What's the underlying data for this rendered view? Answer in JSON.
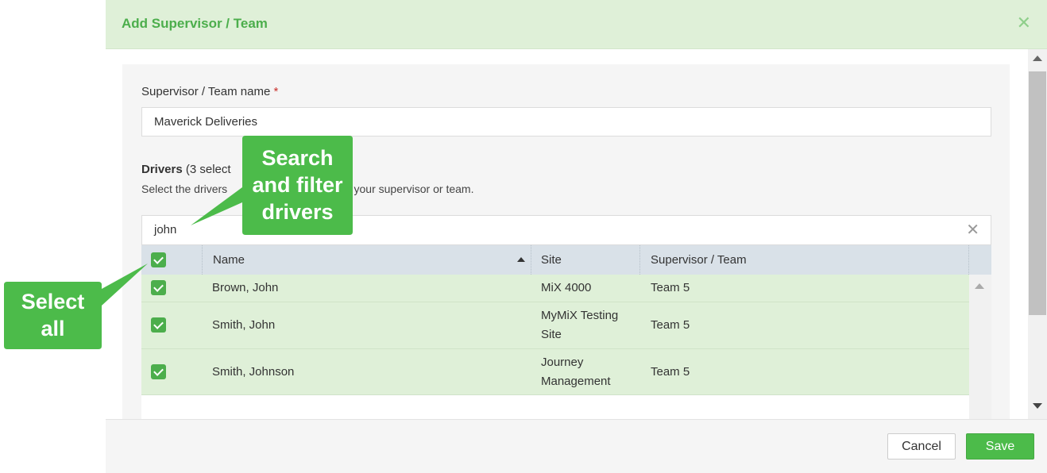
{
  "modal": {
    "title": "Add Supervisor / Team",
    "close_glyph": "✕"
  },
  "form": {
    "name_label": "Supervisor / Team name",
    "required_mark": "*",
    "name_value": "Maverick Deliveries",
    "drivers_label": "Drivers",
    "drivers_count": "(3 select",
    "drivers_help_start": "Select the drivers",
    "drivers_help_end": "to your supervisor or team."
  },
  "search": {
    "value": "john",
    "clear_glyph": "✕"
  },
  "grid": {
    "columns": {
      "name": "Name",
      "site": "Site",
      "team": "Supervisor / Team"
    },
    "rows": [
      {
        "name": "Brown, John",
        "site": "MiX 4000",
        "site2": "",
        "team": "Team 5"
      },
      {
        "name": "Smith, John",
        "site": "MyMiX Testing",
        "site2": "Site",
        "team": "Team 5"
      },
      {
        "name": "Smith, Johnson",
        "site": "Journey",
        "site2": "Management",
        "team": "Team 5"
      }
    ]
  },
  "footer": {
    "cancel_label": "Cancel",
    "save_label": "Save"
  },
  "callouts": {
    "search_line1": "Search",
    "search_line2": "and filter",
    "search_line3": "drivers",
    "select_line1": "Select",
    "select_line2": "all"
  },
  "colors": {
    "accent_green": "#4cae4c",
    "header_bg": "#dff0d8",
    "callout_green": "#4cbb4a"
  },
  "icons": [
    "close-icon",
    "checkbox-checked-icon",
    "sort-ascending-icon",
    "scroll-up-icon",
    "scroll-down-icon"
  ]
}
